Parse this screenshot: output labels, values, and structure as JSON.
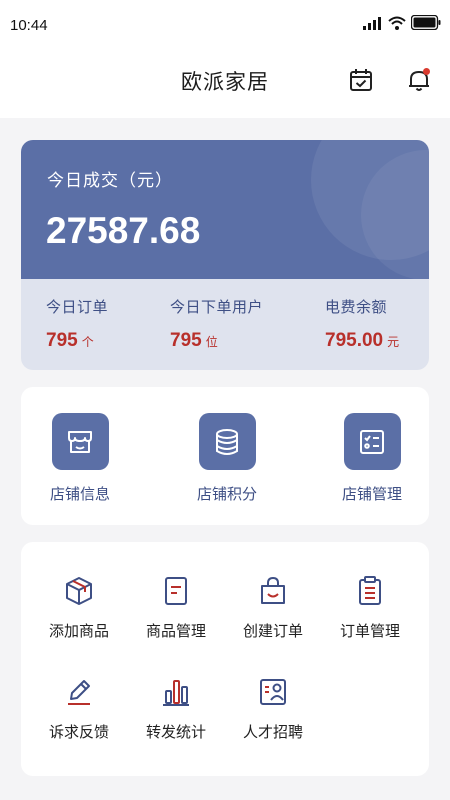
{
  "status_bar": {
    "time": "10:44"
  },
  "header": {
    "title": "欧派家居"
  },
  "summary": {
    "label": "今日成交（元）",
    "amount": "27587.68",
    "stats": [
      {
        "label": "今日订单",
        "value": "795",
        "unit": "个"
      },
      {
        "label": "今日下单用户",
        "value": "795",
        "unit": "位"
      },
      {
        "label": "电费余额",
        "value": "795.00",
        "unit": "元"
      }
    ]
  },
  "shop": {
    "items": [
      {
        "label": "店铺信息",
        "icon": "store-icon"
      },
      {
        "label": "店铺积分",
        "icon": "coin-stack-icon"
      },
      {
        "label": "店铺管理",
        "icon": "checklist-icon"
      }
    ]
  },
  "functions": {
    "items": [
      {
        "label": "添加商品",
        "icon": "package-icon"
      },
      {
        "label": "商品管理",
        "icon": "document-icon"
      },
      {
        "label": "创建订单",
        "icon": "shopping-bag-icon"
      },
      {
        "label": "订单管理",
        "icon": "clipboard-icon"
      },
      {
        "label": "诉求反馈",
        "icon": "edit-icon"
      },
      {
        "label": "转发统计",
        "icon": "bar-chart-icon"
      },
      {
        "label": "人才招聘",
        "icon": "id-card-icon"
      }
    ]
  },
  "colors": {
    "primary": "#5b6fa6",
    "accent_red": "#b8302b",
    "label_blue": "#3e4f85",
    "background": "#f4f4f6"
  }
}
